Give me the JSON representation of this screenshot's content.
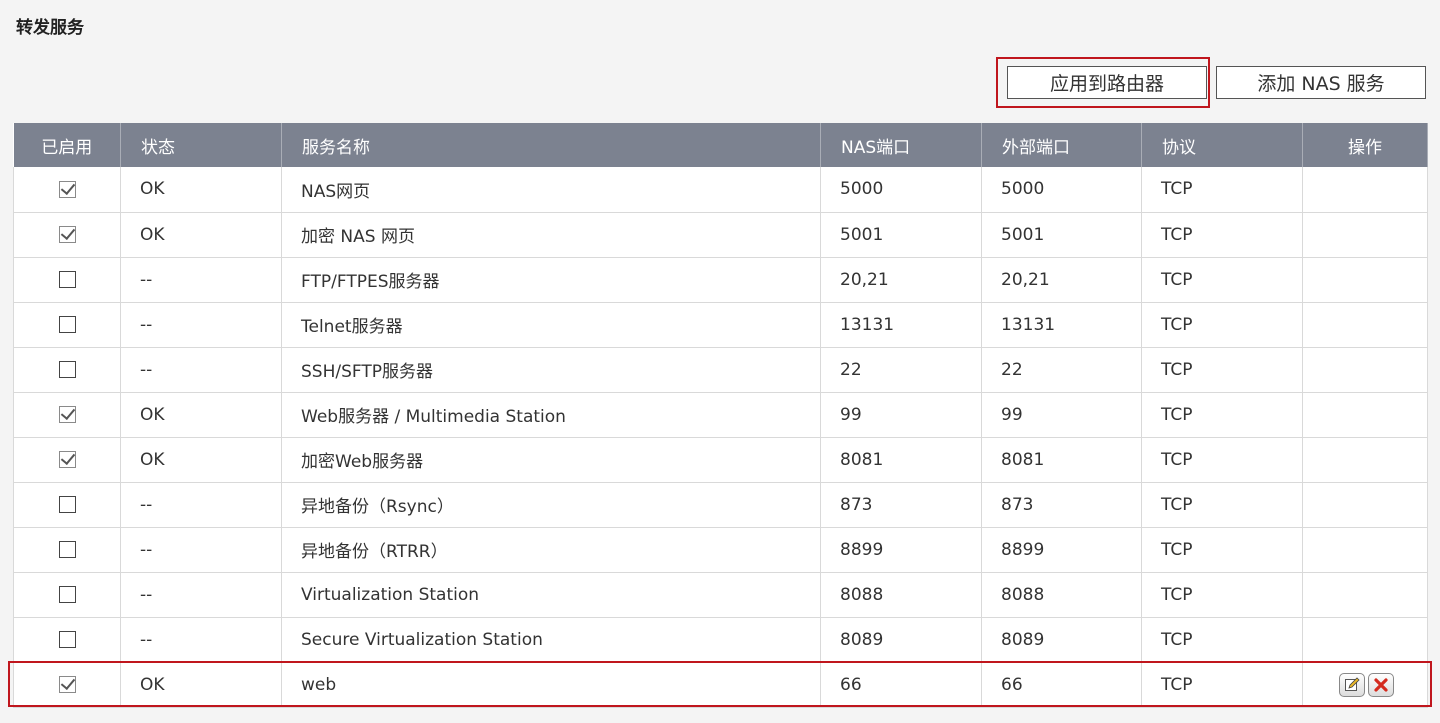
{
  "page": {
    "title": "转发服务"
  },
  "toolbar": {
    "apply_label": "应用到路由器",
    "add_label": "添加 NAS 服务"
  },
  "table": {
    "columns": [
      "已启用",
      "状态",
      "服务名称",
      "NAS端口",
      "外部端口",
      "协议",
      "操作"
    ],
    "rows": [
      {
        "enabled": true,
        "status": "OK",
        "name": "NAS网页",
        "nas_port": "5000",
        "ext_port": "5000",
        "protocol": "TCP"
      },
      {
        "enabled": true,
        "status": "OK",
        "name": "加密 NAS 网页",
        "nas_port": "5001",
        "ext_port": "5001",
        "protocol": "TCP"
      },
      {
        "enabled": false,
        "status": "--",
        "name": "FTP/FTPES服务器",
        "nas_port": "20,21",
        "ext_port": "20,21",
        "protocol": "TCP"
      },
      {
        "enabled": false,
        "status": "--",
        "name": "Telnet服务器",
        "nas_port": "13131",
        "ext_port": "13131",
        "protocol": "TCP"
      },
      {
        "enabled": false,
        "status": "--",
        "name": "SSH/SFTP服务器",
        "nas_port": "22",
        "ext_port": "22",
        "protocol": "TCP"
      },
      {
        "enabled": true,
        "status": "OK",
        "name": "Web服务器 / Multimedia Station",
        "nas_port": "99",
        "ext_port": "99",
        "protocol": "TCP"
      },
      {
        "enabled": true,
        "status": "OK",
        "name": "加密Web服务器",
        "nas_port": "8081",
        "ext_port": "8081",
        "protocol": "TCP"
      },
      {
        "enabled": false,
        "status": "--",
        "name": "异地备份（Rsync）",
        "nas_port": "873",
        "ext_port": "873",
        "protocol": "TCP"
      },
      {
        "enabled": false,
        "status": "--",
        "name": "异地备份（RTRR）",
        "nas_port": "8899",
        "ext_port": "8899",
        "protocol": "TCP"
      },
      {
        "enabled": false,
        "status": "--",
        "name": "Virtualization Station",
        "nas_port": "8088",
        "ext_port": "8088",
        "protocol": "TCP"
      },
      {
        "enabled": false,
        "status": "--",
        "name": "Secure Virtualization Station",
        "nas_port": "8089",
        "ext_port": "8089",
        "protocol": "TCP"
      },
      {
        "enabled": true,
        "status": "OK",
        "name": "web",
        "nas_port": "66",
        "ext_port": "66",
        "protocol": "TCP",
        "actions": [
          "edit-icon",
          "delete-icon"
        ]
      }
    ]
  },
  "colors": {
    "header_bg": "#7c8290",
    "highlight": "#c0161d",
    "delete": "#d42a1e"
  }
}
